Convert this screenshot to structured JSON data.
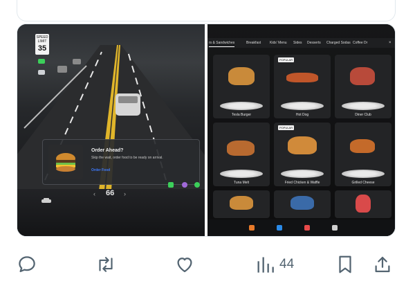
{
  "left_panel": {
    "speed_sign": {
      "label": "SPEED LIMIT",
      "value": "35"
    },
    "order_card": {
      "title": "Order Ahead?",
      "text": "Skip the wait, order food to be ready on arrival.",
      "link": "Order Food"
    },
    "speed": "66"
  },
  "right_panel": {
    "tabs": [
      "rs & Sandwiches",
      "Breakfast",
      "Kids' Menu",
      "Sides",
      "Desserts",
      "Charged Sodas",
      "Coffee Dr"
    ],
    "items": [
      {
        "name": "Tesla Burger",
        "badge": ""
      },
      {
        "name": "Hot Dog",
        "badge": "POPULAR"
      },
      {
        "name": "Diner Club",
        "badge": ""
      },
      {
        "name": "Tuna Melt",
        "badge": ""
      },
      {
        "name": "Fried Chicken & Waffle",
        "badge": "POPULAR"
      },
      {
        "name": "Grilled Cheese",
        "badge": ""
      }
    ]
  },
  "actions": {
    "views": "44",
    "icons": [
      "reply-icon",
      "retweet-icon",
      "like-icon",
      "views-icon",
      "bookmark-icon",
      "share-icon"
    ]
  },
  "colors": {
    "link_blue": "#3e7bff",
    "icon_gray": "#536471"
  }
}
